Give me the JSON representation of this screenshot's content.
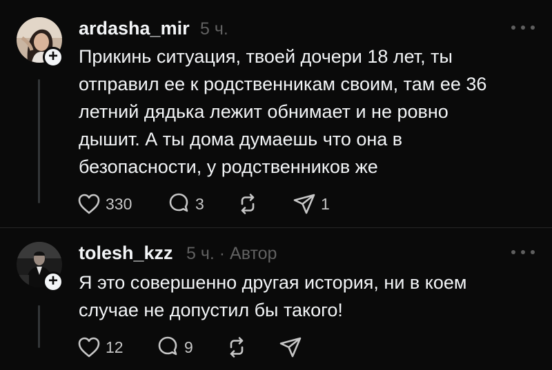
{
  "comments": [
    {
      "username": "ardasha_mir",
      "time": "5 ч.",
      "author_tag": "",
      "lines": [
        "Прикинь ситуация, твоей дочери 18 лет, ты",
        "отправил ее к родственникам своим, там ее 36",
        "летний дядька лежит обнимает и не ровно",
        "дышит. А ты дома думаешь что она в",
        "безопасности, у родственников же"
      ],
      "likes": "330",
      "replies": "3",
      "reposts": "",
      "shares": "1"
    },
    {
      "username": "tolesh_kzz",
      "time": "5 ч.",
      "author_tag": "· Автор",
      "lines": [
        "Я это совершенно другая история, ни в коем",
        "случае не допустил бы такого!"
      ],
      "likes": "12",
      "replies": "9",
      "reposts": "",
      "shares": ""
    }
  ],
  "icons": {
    "like": "heart-icon",
    "reply": "comment-icon",
    "repost": "repost-icon",
    "share": "send-icon",
    "more": "more-icon",
    "follow": "plus-icon"
  },
  "colors": {
    "background": "#0a0a0a",
    "text": "#f3f5f7",
    "muted": "#616161",
    "icon": "#c7c7c7"
  }
}
